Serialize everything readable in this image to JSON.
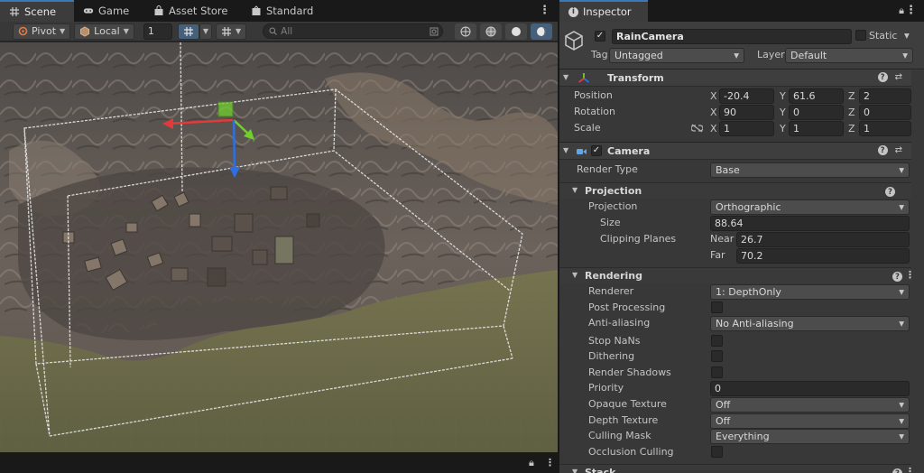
{
  "scene_tabs": [
    {
      "label": "Scene",
      "icon": "grid-icon",
      "active": true
    },
    {
      "label": "Game",
      "icon": "gamepad-icon",
      "active": false
    },
    {
      "label": "Asset Store",
      "icon": "bag-icon",
      "active": false
    },
    {
      "label": "Standard",
      "icon": "cast-icon",
      "active": false
    }
  ],
  "toolbar": {
    "pivot_label": "Pivot",
    "space_label": "Local",
    "snap_value": "1",
    "search_placeholder": "All"
  },
  "inspector": {
    "tab_label": "Inspector",
    "object_name": "RainCamera",
    "static_label": "Static",
    "tag_label": "Tag",
    "tag_value": "Untagged",
    "layer_label": "Layer",
    "layer_value": "Default"
  },
  "transform": {
    "title": "Transform",
    "position_label": "Position",
    "rotation_label": "Rotation",
    "scale_label": "Scale",
    "position": {
      "x": "-20.4",
      "y": "61.6",
      "z": "2"
    },
    "rotation": {
      "x": "90",
      "y": "0",
      "z": "0"
    },
    "scale": {
      "x": "1",
      "y": "1",
      "z": "1"
    },
    "axis_x": "X",
    "axis_y": "Y",
    "axis_z": "Z"
  },
  "camera": {
    "title": "Camera",
    "render_type_label": "Render Type",
    "render_type_value": "Base",
    "projection_section": "Projection",
    "projection_label": "Projection",
    "projection_value": "Orthographic",
    "size_label": "Size",
    "size_value": "88.64",
    "clipping_label": "Clipping Planes",
    "near_label": "Near",
    "near_value": "26.7",
    "far_label": "Far",
    "far_value": "70.2",
    "rendering_section": "Rendering",
    "renderer_label": "Renderer",
    "renderer_value": "1: DepthOnly",
    "post_processing_label": "Post Processing",
    "anti_aliasing_label": "Anti-aliasing",
    "anti_aliasing_value": "No Anti-aliasing",
    "stop_nans_label": "Stop NaNs",
    "dithering_label": "Dithering",
    "render_shadows_label": "Render Shadows",
    "priority_label": "Priority",
    "priority_value": "0",
    "opaque_texture_label": "Opaque Texture",
    "opaque_texture_value": "Off",
    "depth_texture_label": "Depth Texture",
    "depth_texture_value": "Off",
    "culling_mask_label": "Culling Mask",
    "culling_mask_value": "Everything",
    "occlusion_culling_label": "Occlusion Culling",
    "stack_section": "Stack"
  },
  "colors": {
    "accent": "#3a79bb",
    "axis_x": "#e23a3a",
    "axis_y": "#6fd02d",
    "axis_z": "#2f6fe2"
  }
}
